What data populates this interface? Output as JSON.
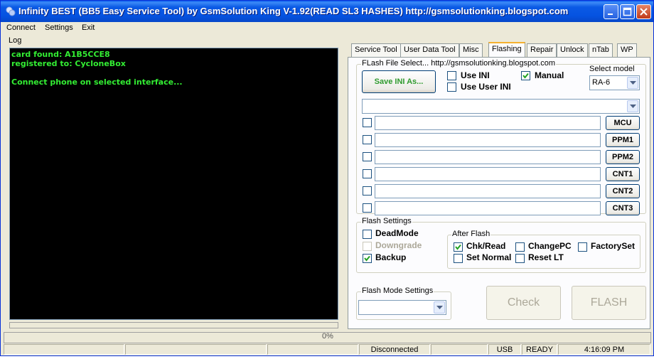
{
  "window": {
    "title": "Infinity BEST (BB5 Easy Service Tool) by GsmSolution King V-1.92(READ SL3 HASHES) http://gsmsolutionking.blogspot.com"
  },
  "menu": [
    "Connect",
    "Settings",
    "Exit"
  ],
  "log": {
    "label": "Log",
    "lines": [
      "card found: A1B5CCE8",
      "registered to: CycloneBox",
      "",
      "Connect phone on selected interface..."
    ]
  },
  "tabs": [
    "Service Tool",
    "User Data Tool",
    "Misc",
    "Flashing",
    "Repair",
    "Unlock",
    "nTab",
    "WP"
  ],
  "active_tab": "Flashing",
  "flash_file": {
    "group_title": "FLash File Select... http://gsmsolutionking.blogspot.com",
    "save_ini_label": "Save INI As...",
    "use_ini": {
      "label": "Use INI",
      "checked": false
    },
    "manual": {
      "label": "Manual",
      "checked": true
    },
    "use_user_ini": {
      "label": "Use User INI",
      "checked": false
    },
    "select_model_label": "Select model",
    "model_value": "RA-6",
    "file_rows": [
      {
        "button": "MCU",
        "checked": false,
        "value": ""
      },
      {
        "button": "PPM1",
        "checked": false,
        "value": ""
      },
      {
        "button": "PPM2",
        "checked": false,
        "value": ""
      },
      {
        "button": "CNT1",
        "checked": false,
        "value": ""
      },
      {
        "button": "CNT2",
        "checked": false,
        "value": ""
      },
      {
        "button": "CNT3",
        "checked": false,
        "value": ""
      }
    ]
  },
  "flash_settings": {
    "title": "Flash Settings",
    "deadmode": {
      "label": "DeadMode",
      "checked": false
    },
    "downgrade": {
      "label": "Downgrade",
      "checked": false,
      "disabled": true
    },
    "backup": {
      "label": "Backup",
      "checked": true
    },
    "after_flash": {
      "title": "After Flash",
      "chk_read": {
        "label": "Chk/Read",
        "checked": true
      },
      "change_pc": {
        "label": "ChangePC",
        "checked": false
      },
      "factory_set": {
        "label": "FactorySet",
        "checked": false
      },
      "set_normal": {
        "label": "Set Normal",
        "checked": false
      },
      "reset_lt": {
        "label": "Reset LT",
        "checked": false
      }
    }
  },
  "flash_mode": {
    "title": "Flash Mode Settings",
    "value": ""
  },
  "actions": {
    "check_label": "Check",
    "flash_label": "FLASH"
  },
  "progress": {
    "value": 0,
    "text": "0%"
  },
  "status": {
    "connection": "Disconnected",
    "port": "USB",
    "state": "READY",
    "time": "4:16:09 PM"
  },
  "colors": {
    "title_bar": "#0553e1",
    "log_text": "#33ee33",
    "tab_highlight": "#f5b12f"
  },
  "icons": [
    "app-icon",
    "minimize-icon",
    "maximize-icon",
    "close-icon",
    "check-icon",
    "dropdown-arrow-icon"
  ]
}
